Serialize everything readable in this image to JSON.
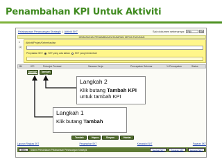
{
  "slide": {
    "title": "Penambahan KPI Untuk Aktiviti",
    "title_color": "#3f8a1f"
  },
  "app": {
    "breadcrumbs": [
      "Pelaksanaan Perancangan Strategik",
      "Aktiviti SKT"
    ],
    "manager_label": "Saiz dokumen sebenarnya:",
    "select_value": "Pilih",
    "go_label": "Go",
    "header_band": "KEMASUKAN PENAMBAHAN SASARAN KERJA TAHUNAN",
    "gutter": [
      "1",
      "(1)"
    ],
    "yellow_box": {
      "label": "Aktiviti/Projek/Keberhasilan",
      "radio_label": "Penyataan SKT:",
      "radio_1": "SKT yang ada kaitan",
      "radio_2": "SKT yang bertambah"
    },
    "kpi_table": {
      "headers": {
        "bil": "Bil",
        "kpi": "KPI",
        "fokus": "Petunjuk Prestasi",
        "sasaran": "Sasaran Kerja",
        "pencapaian": "Pencapaian Sebenar",
        "peratus": "% Pencapaian",
        "status": "Status"
      }
    },
    "buttons": {
      "tambah_top": "Tambah",
      "kpi": "Tambah KPI",
      "tambah": "Tambah",
      "hapus": "Hapus",
      "simpan": "Simpan",
      "hantar": "Hantar"
    },
    "footer_links": [
      "Laporan Ringkas SKT",
      "Pengesahan SKT",
      "Kemaskini SKT",
      "Paparan SKT"
    ],
    "footer_bar": {
      "btn": "Menu",
      "text": "Sistem Pemantauan Pelaksanaan Perancangan Strategik",
      "links": [
        "Tambah SKT",
        "Paparan SKT",
        "Laporan SKT"
      ]
    }
  },
  "callouts": {
    "step2": {
      "title": "Langkah 2",
      "body_pre": "Klik butang ",
      "body_bold": "Tambah KPI",
      "body_post": " untuk tambah KPI"
    },
    "step1": {
      "title": "Langkah 1",
      "body_pre": "Klik butang ",
      "body_bold": "Tambah"
    }
  }
}
